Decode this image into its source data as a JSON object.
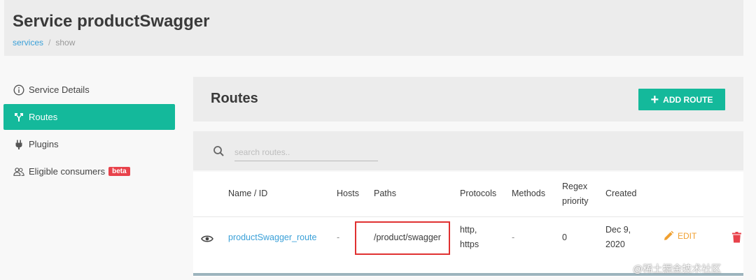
{
  "header": {
    "title": "Service productSwagger",
    "breadcrumb": {
      "link": "services",
      "separator": "/",
      "current": "show"
    }
  },
  "sidebar": {
    "items": [
      {
        "label": "Service Details",
        "icon": "info-icon",
        "active": false
      },
      {
        "label": "Routes",
        "icon": "routes-icon",
        "active": true
      },
      {
        "label": "Plugins",
        "icon": "plug-icon",
        "active": false
      },
      {
        "label": "Eligible consumers",
        "icon": "users-icon",
        "active": false,
        "badge": "beta"
      }
    ]
  },
  "routes": {
    "title": "Routes",
    "add_button": "ADD ROUTE",
    "search": {
      "placeholder": "search routes..",
      "value": ""
    },
    "columns": [
      "Name / ID",
      "Hosts",
      "Paths",
      "Protocols",
      "Methods",
      "Regex priority",
      "Created"
    ],
    "rows": [
      {
        "name": "productSwagger_route",
        "hosts": "-",
        "paths": "/product/swagger",
        "protocols": "http, https",
        "methods": "-",
        "regex_priority": "0",
        "created": "Dec 9, 2020",
        "edit_label": "EDIT"
      }
    ]
  },
  "watermark": "@稀土掘金技术社区",
  "colors": {
    "accent": "#14b99b",
    "link": "#3aa0d8",
    "edit": "#f0a030",
    "delete": "#e8424b",
    "highlight": "#e03131"
  }
}
